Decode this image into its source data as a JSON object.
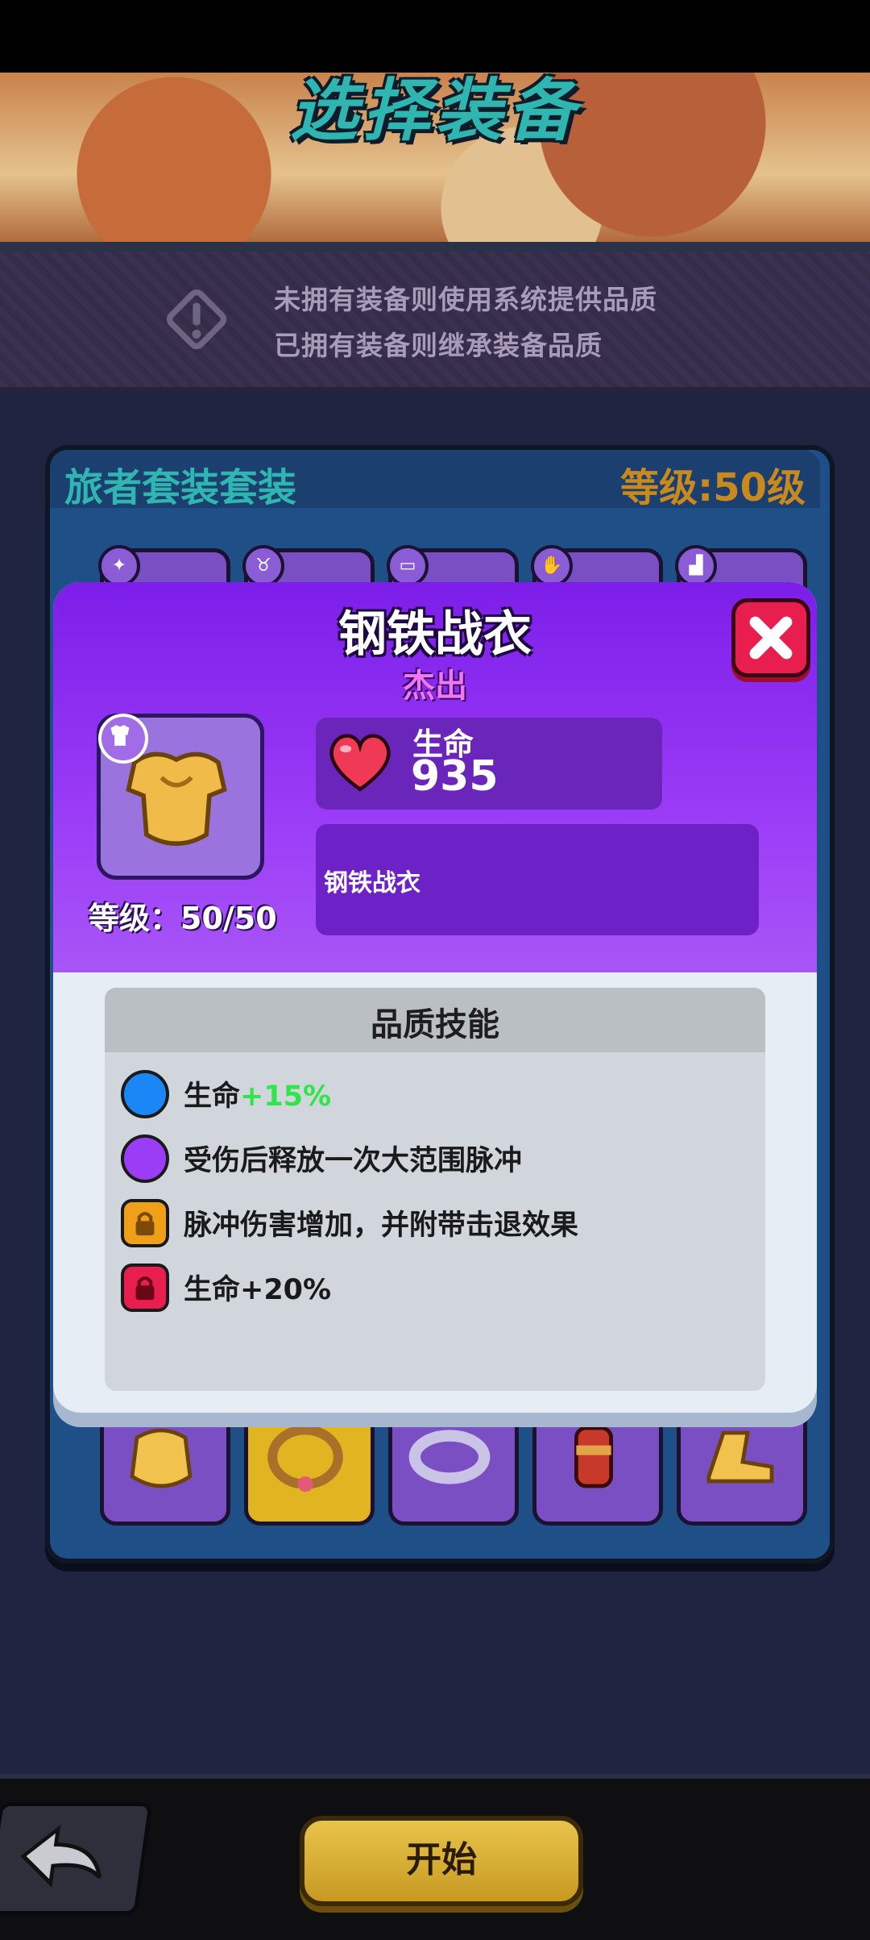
{
  "banner": {
    "title": "选择装备"
  },
  "notice": {
    "line1": "未拥有装备则使用系统提供品质",
    "line2": "已拥有装备则继承装备品质"
  },
  "set_panel": {
    "name": "旅者套装套装",
    "level": "等级:50级"
  },
  "modal": {
    "title": "钢铁战衣",
    "rarity": "杰出",
    "level": "等级：50/50",
    "stat": {
      "label": "生命",
      "value": "935"
    },
    "description": "钢铁战衣",
    "skills_title": "品质技能",
    "skills": [
      {
        "prefix": "生命",
        "bonus": "+15%",
        "state": "unlocked-blue"
      },
      {
        "prefix": "受伤后释放一次大范围脉冲",
        "bonus": "",
        "state": "unlocked-purple"
      },
      {
        "prefix": "脉冲伤害增加，并附带击退效果",
        "bonus": "",
        "state": "locked-orange"
      },
      {
        "prefix": "生命+20%",
        "bonus": "",
        "state": "locked-red"
      }
    ]
  },
  "bottom": {
    "start_label": "开始"
  },
  "colors": {
    "accent_purple": "#9b3cf7",
    "close_red": "#e81e4e",
    "bonus_green": "#2ee64a",
    "start_gold": "#e8c34a"
  }
}
